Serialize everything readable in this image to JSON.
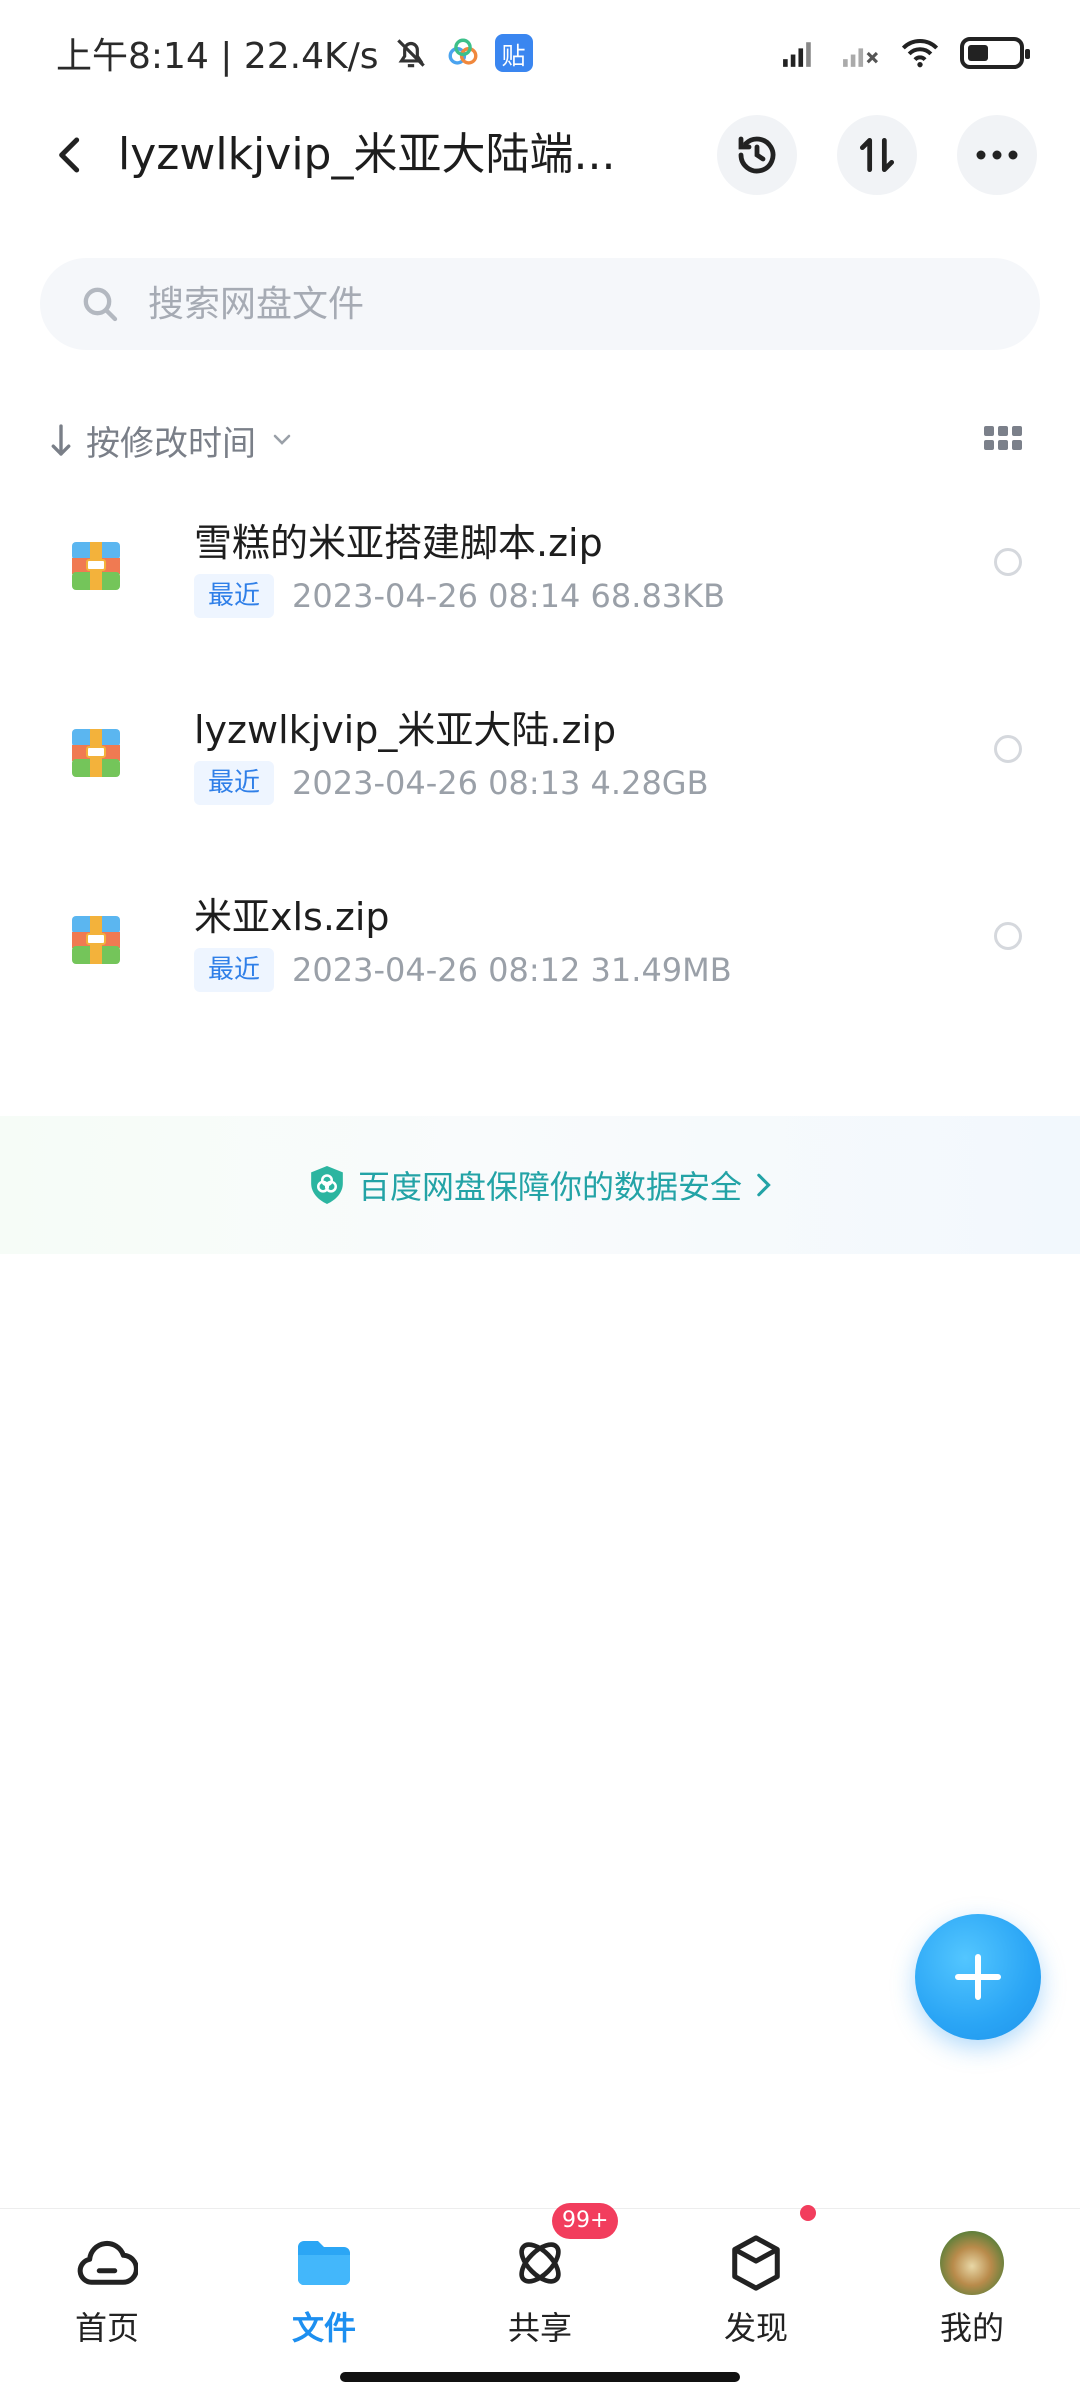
{
  "status_bar": {
    "time_speed": "上午8:14 | 22.4K/s",
    "tie_badge": "贴"
  },
  "header": {
    "title": "lyzwlkjvip_米亚大陆端..."
  },
  "search": {
    "placeholder": "搜索网盘文件"
  },
  "sort": {
    "label": "按修改时间"
  },
  "files": [
    {
      "name": "雪糕的米亚搭建脚本.zip",
      "tag": "最近",
      "meta": "2023-04-26  08:14  68.83KB"
    },
    {
      "name": "lyzwlkjvip_米亚大陆.zip",
      "tag": "最近",
      "meta": "2023-04-26  08:13  4.28GB"
    },
    {
      "name": "米亚xls.zip",
      "tag": "最近",
      "meta": "2023-04-26  08:12  31.49MB"
    }
  ],
  "security_banner": {
    "text": "百度网盘保障你的数据安全"
  },
  "bottom_nav": {
    "items": [
      {
        "label": "首页"
      },
      {
        "label": "文件"
      },
      {
        "label": "共享",
        "badge": "99+"
      },
      {
        "label": "发现"
      },
      {
        "label": "我的"
      }
    ]
  },
  "colors": {
    "accent": "#1d8ff0",
    "badge": "#f23d5d",
    "security_text": "#23a3a6"
  }
}
